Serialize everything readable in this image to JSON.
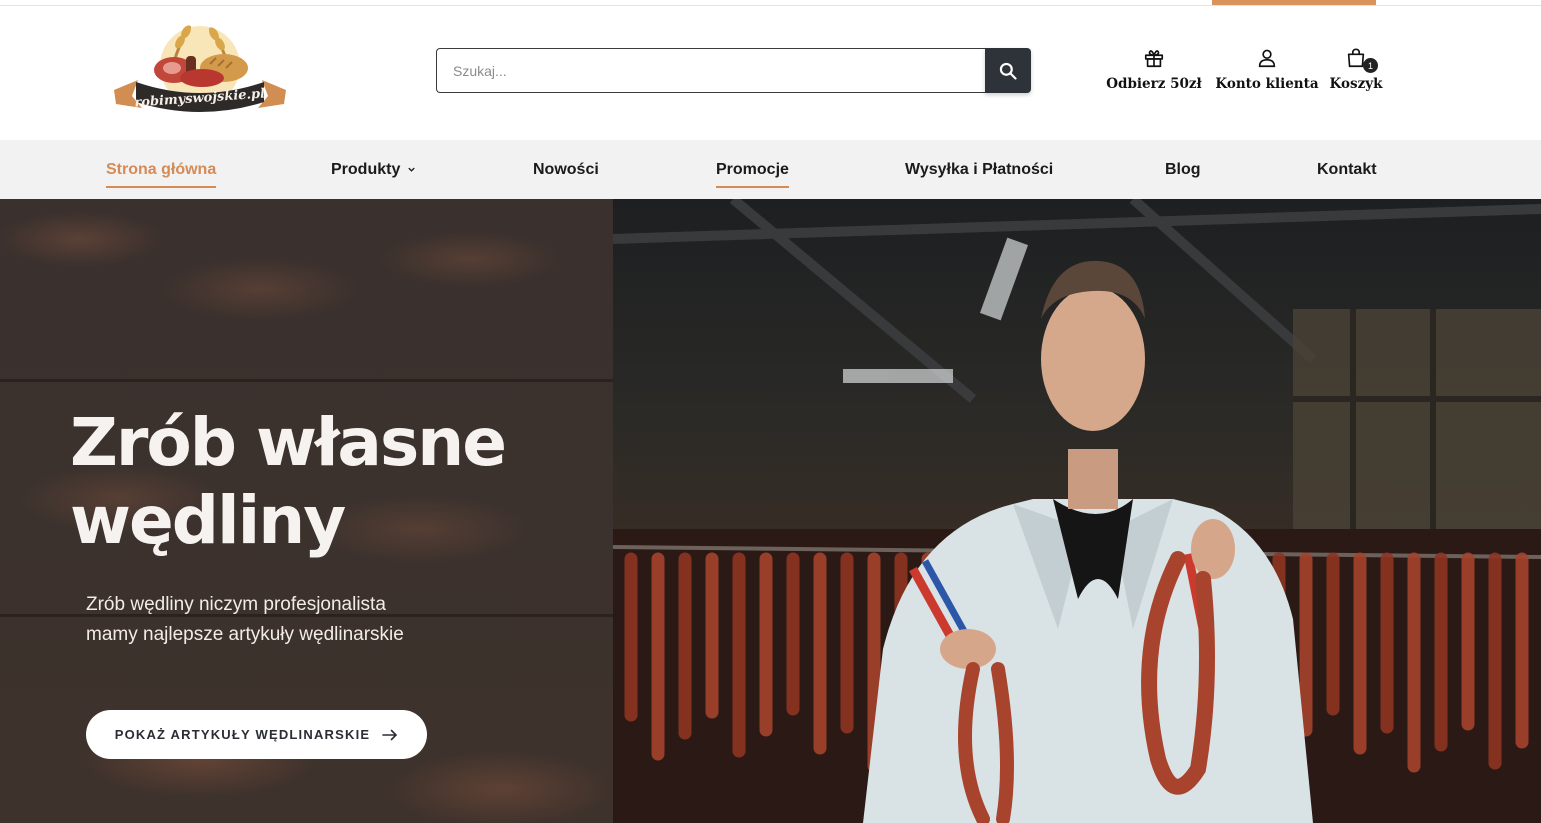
{
  "brand": {
    "logo_text": "robimyswojskie.pl",
    "accent_color": "#d58b56"
  },
  "search": {
    "placeholder": "Szukaj...",
    "value": "",
    "button_icon": "search-icon"
  },
  "header_links": [
    {
      "label": "Odbierz 50zł",
      "icon": "gift-icon"
    },
    {
      "label": "Konto klienta",
      "icon": "user-icon"
    },
    {
      "label": "Koszyk",
      "icon": "shopping-bag-icon",
      "badge": "1"
    }
  ],
  "nav": {
    "items": [
      {
        "label": "Strona główna",
        "active": true
      },
      {
        "label": "Produkty",
        "has_dropdown": true
      },
      {
        "label": "Nowości"
      },
      {
        "label": "Promocje",
        "underlined": true
      },
      {
        "label": "Wysyłka i Płatności"
      },
      {
        "label": "Blog"
      },
      {
        "label": "Kontakt"
      }
    ]
  },
  "hero": {
    "title_line1": "Zrób własne",
    "title_line2": "wędliny",
    "subtitle_line1": "Zrób wędliny niczym profesjonalista",
    "subtitle_line2": "mamy najlepsze artykuły wędlinarskie",
    "cta_label": "POKAŻ ARTYKUŁY WĘDLINARSKIE",
    "cta_icon": "arrow-right-icon"
  }
}
